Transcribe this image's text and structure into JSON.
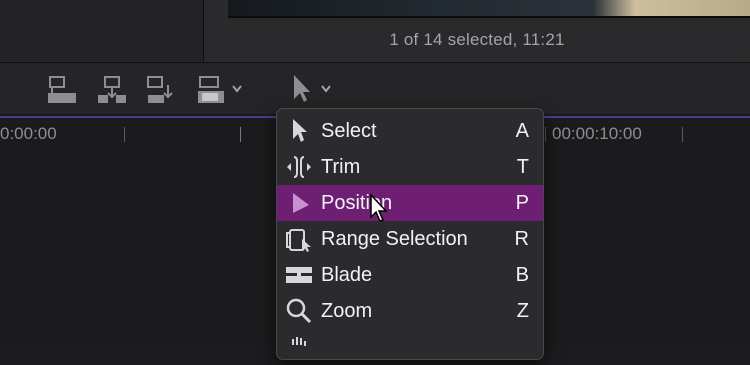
{
  "viewer": {
    "selection_status": "1 of 14 selected, 11:21"
  },
  "toolbar": {
    "buttons": [
      {
        "icon": "connect-clip-icon"
      },
      {
        "icon": "insert-clip-icon"
      },
      {
        "icon": "append-clip-icon"
      },
      {
        "icon": "overwrite-clip-icon"
      }
    ],
    "tool_icon": "arrow-tool-icon"
  },
  "timeline": {
    "timecodes": [
      "0:00:00",
      "00:00:10:00"
    ],
    "accent_color": "#4a3f8f"
  },
  "menu": {
    "highlight_color": "#6e1f74",
    "items": [
      {
        "label": "Select",
        "key": "A",
        "icon": "arrow-icon"
      },
      {
        "label": "Trim",
        "key": "T",
        "icon": "trim-icon"
      },
      {
        "label": "Position",
        "key": "P",
        "icon": "position-icon",
        "selected": true
      },
      {
        "label": "Range Selection",
        "key": "R",
        "icon": "range-selection-icon"
      },
      {
        "label": "Blade",
        "key": "B",
        "icon": "blade-icon"
      },
      {
        "label": "Zoom",
        "key": "Z",
        "icon": "zoom-icon"
      }
    ]
  }
}
